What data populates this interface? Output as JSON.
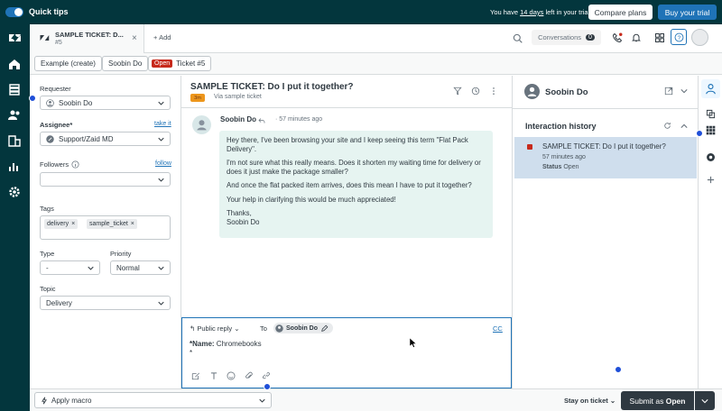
{
  "banner": {
    "quick_tips": "Quick tips",
    "trial_prefix": "You have ",
    "trial_days": "14 days",
    "trial_suffix": " left in your trial",
    "compare_plans": "Compare plans",
    "buy_trial": "Buy your trial"
  },
  "tabbar": {
    "tab_title": "SAMPLE TICKET: D...",
    "tab_sub": "#5",
    "add_label": "Add",
    "conversations_label": "Conversations",
    "conversations_count": "0"
  },
  "breadcrumb": {
    "org": "Example (create)",
    "user": "Soobin Do",
    "status": "Open",
    "ticket": "Ticket #5"
  },
  "properties": {
    "requester_label": "Requester",
    "requester_value": "Soobin Do",
    "assignee_label": "Assignee*",
    "take_it": "take it",
    "assignee_value": "Support/Zaid MD",
    "followers_label": "Followers",
    "follow_link": "follow",
    "tags_label": "Tags",
    "tags": [
      "delivery",
      "sample_ticket"
    ],
    "type_label": "Type",
    "type_value": "-",
    "priority_label": "Priority",
    "priority_value": "Normal",
    "topic_label": "Topic",
    "topic_value": "Delivery"
  },
  "conversation": {
    "title": "SAMPLE TICKET: Do I put it together?",
    "channel_badge": "3m",
    "via": "Via sample ticket",
    "author": "Soobin Do",
    "time": "57 minutes ago",
    "paragraphs": [
      "Hey there, I've been browsing your site and I keep seeing this term \"Flat Pack Delivery\".",
      "I'm not sure what this really means. Does it shorten my waiting time for delivery or does it just make the package smaller?",
      "And once the flat packed item arrives, does this mean I have to put it together?",
      "Your help in clarifying this would be much appreciated!",
      "Thanks,\nSoobin Do"
    ]
  },
  "composer": {
    "mode": "Public reply",
    "to_label": "To",
    "to_name": "Soobin Do",
    "cc": "CC",
    "body_label": "*Name:",
    "body_value": " Chromebooks",
    "body_line2": "*"
  },
  "right_panel": {
    "requester_name": "Soobin Do",
    "history_title": "Interaction history",
    "item_title": "SAMPLE TICKET: Do I put it together?",
    "item_time": "57 minutes ago",
    "item_status_label": "Status",
    "item_status_value": "Open"
  },
  "bottom": {
    "apply_macro": "Apply macro",
    "stay_on_ticket": "Stay on ticket",
    "submit_prefix": "Submit as ",
    "submit_status": "Open"
  },
  "colors": {
    "brand_dark": "#03363d",
    "accent_blue": "#1f73b7",
    "open_red": "#c72a1c",
    "bubble_bg": "#e6f4f1"
  }
}
